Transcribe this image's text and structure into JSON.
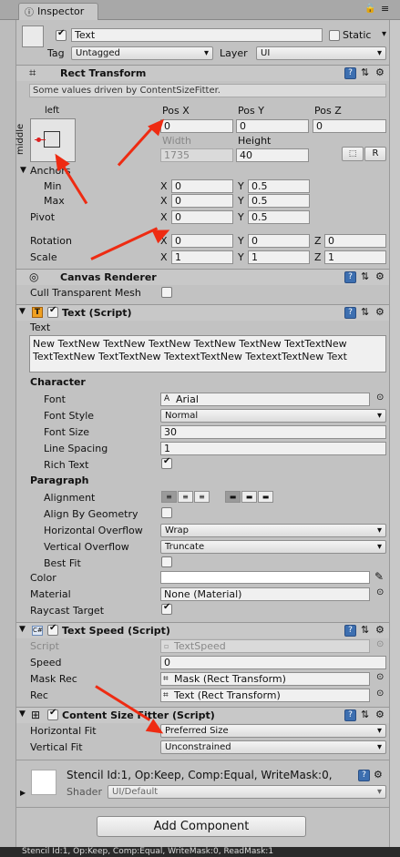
{
  "tab": {
    "title": "Inspector"
  },
  "header": {
    "name": "Text",
    "static_label": "Static",
    "tag_label": "Tag",
    "tag_value": "Untagged",
    "layer_label": "Layer",
    "layer_value": "UI"
  },
  "rect": {
    "title": "Rect Transform",
    "note": "Some values driven by ContentSizeFitter.",
    "anchor_h": "left",
    "anchor_v": "middle",
    "posx_label": "Pos X",
    "posy_label": "Pos Y",
    "posz_label": "Pos Z",
    "posx": "0",
    "posy": "0",
    "posz": "0",
    "width_label": "Width",
    "height_label": "Height",
    "width": "1735",
    "height": "40",
    "r_label": "R",
    "anchors_label": "Anchors",
    "min_label": "Min",
    "max_label": "Max",
    "x": "X",
    "y": "Y",
    "z": "Z",
    "min_x": "0",
    "min_y": "0.5",
    "max_x": "0",
    "max_y": "0.5",
    "pivot_label": "Pivot",
    "pivot_x": "0",
    "pivot_y": "0.5",
    "rotation_label": "Rotation",
    "rot_x": "0",
    "rot_y": "0",
    "rot_z": "0",
    "scale_label": "Scale",
    "scale_x": "1",
    "scale_y": "1",
    "scale_z": "1"
  },
  "canvas": {
    "title": "Canvas Renderer",
    "cull_label": "Cull Transparent Mesh"
  },
  "textscript": {
    "title": "Text (Script)",
    "text_label": "Text",
    "text_line1": "New TextNew TextNew TextNew TextNew TextNew TextTextNew",
    "text_line2": "TextTextNew TextTextNew TextextTextNew TextextTextNew Text",
    "character_label": "Character",
    "font_label": "Font",
    "font_value": "Arial",
    "style_label": "Font Style",
    "style_value": "Normal",
    "size_label": "Font Size",
    "size_value": "30",
    "spacing_label": "Line Spacing",
    "spacing_value": "1",
    "rich_label": "Rich Text",
    "paragraph_label": "Paragraph",
    "alignment_label": "Alignment",
    "geometry_label": "Align By Geometry",
    "hoverflow_label": "Horizontal Overflow",
    "hoverflow_value": "Wrap",
    "voverflow_label": "Vertical Overflow",
    "voverflow_value": "Truncate",
    "bestfit_label": "Best Fit",
    "color_label": "Color",
    "material_label": "Material",
    "material_value": "None (Material)",
    "raycast_label": "Raycast Target"
  },
  "speed": {
    "title": "Text Speed (Script)",
    "script_label": "Script",
    "script_value": "TextSpeed",
    "speed_label": "Speed",
    "speed_value": "0",
    "maskrec_label": "Mask Rec",
    "maskrec_value": "Mask (Rect Transform)",
    "rec_label": "Rec",
    "rec_value": "Text (Rect Transform)"
  },
  "fitter": {
    "title": "Content Size Fitter (Script)",
    "hfit_label": "Horizontal Fit",
    "hfit_value": "Preferred Size",
    "vfit_label": "Vertical Fit",
    "vfit_value": "Unconstrained"
  },
  "material": {
    "stencil": "Stencil Id:1, Op:Keep, Comp:Equal, WriteMask:0,",
    "shader_label": "Shader",
    "shader_value": "UI/Default"
  },
  "add_component": "Add Component",
  "bottom_text": "Stencil Id:1, Op:Keep, Comp:Equal, WriteMask:0, ReadMask:1",
  "colors": {
    "annotation": "#ee2b12",
    "panel": "#c2c2c2",
    "accent": "#3d6fb0"
  }
}
